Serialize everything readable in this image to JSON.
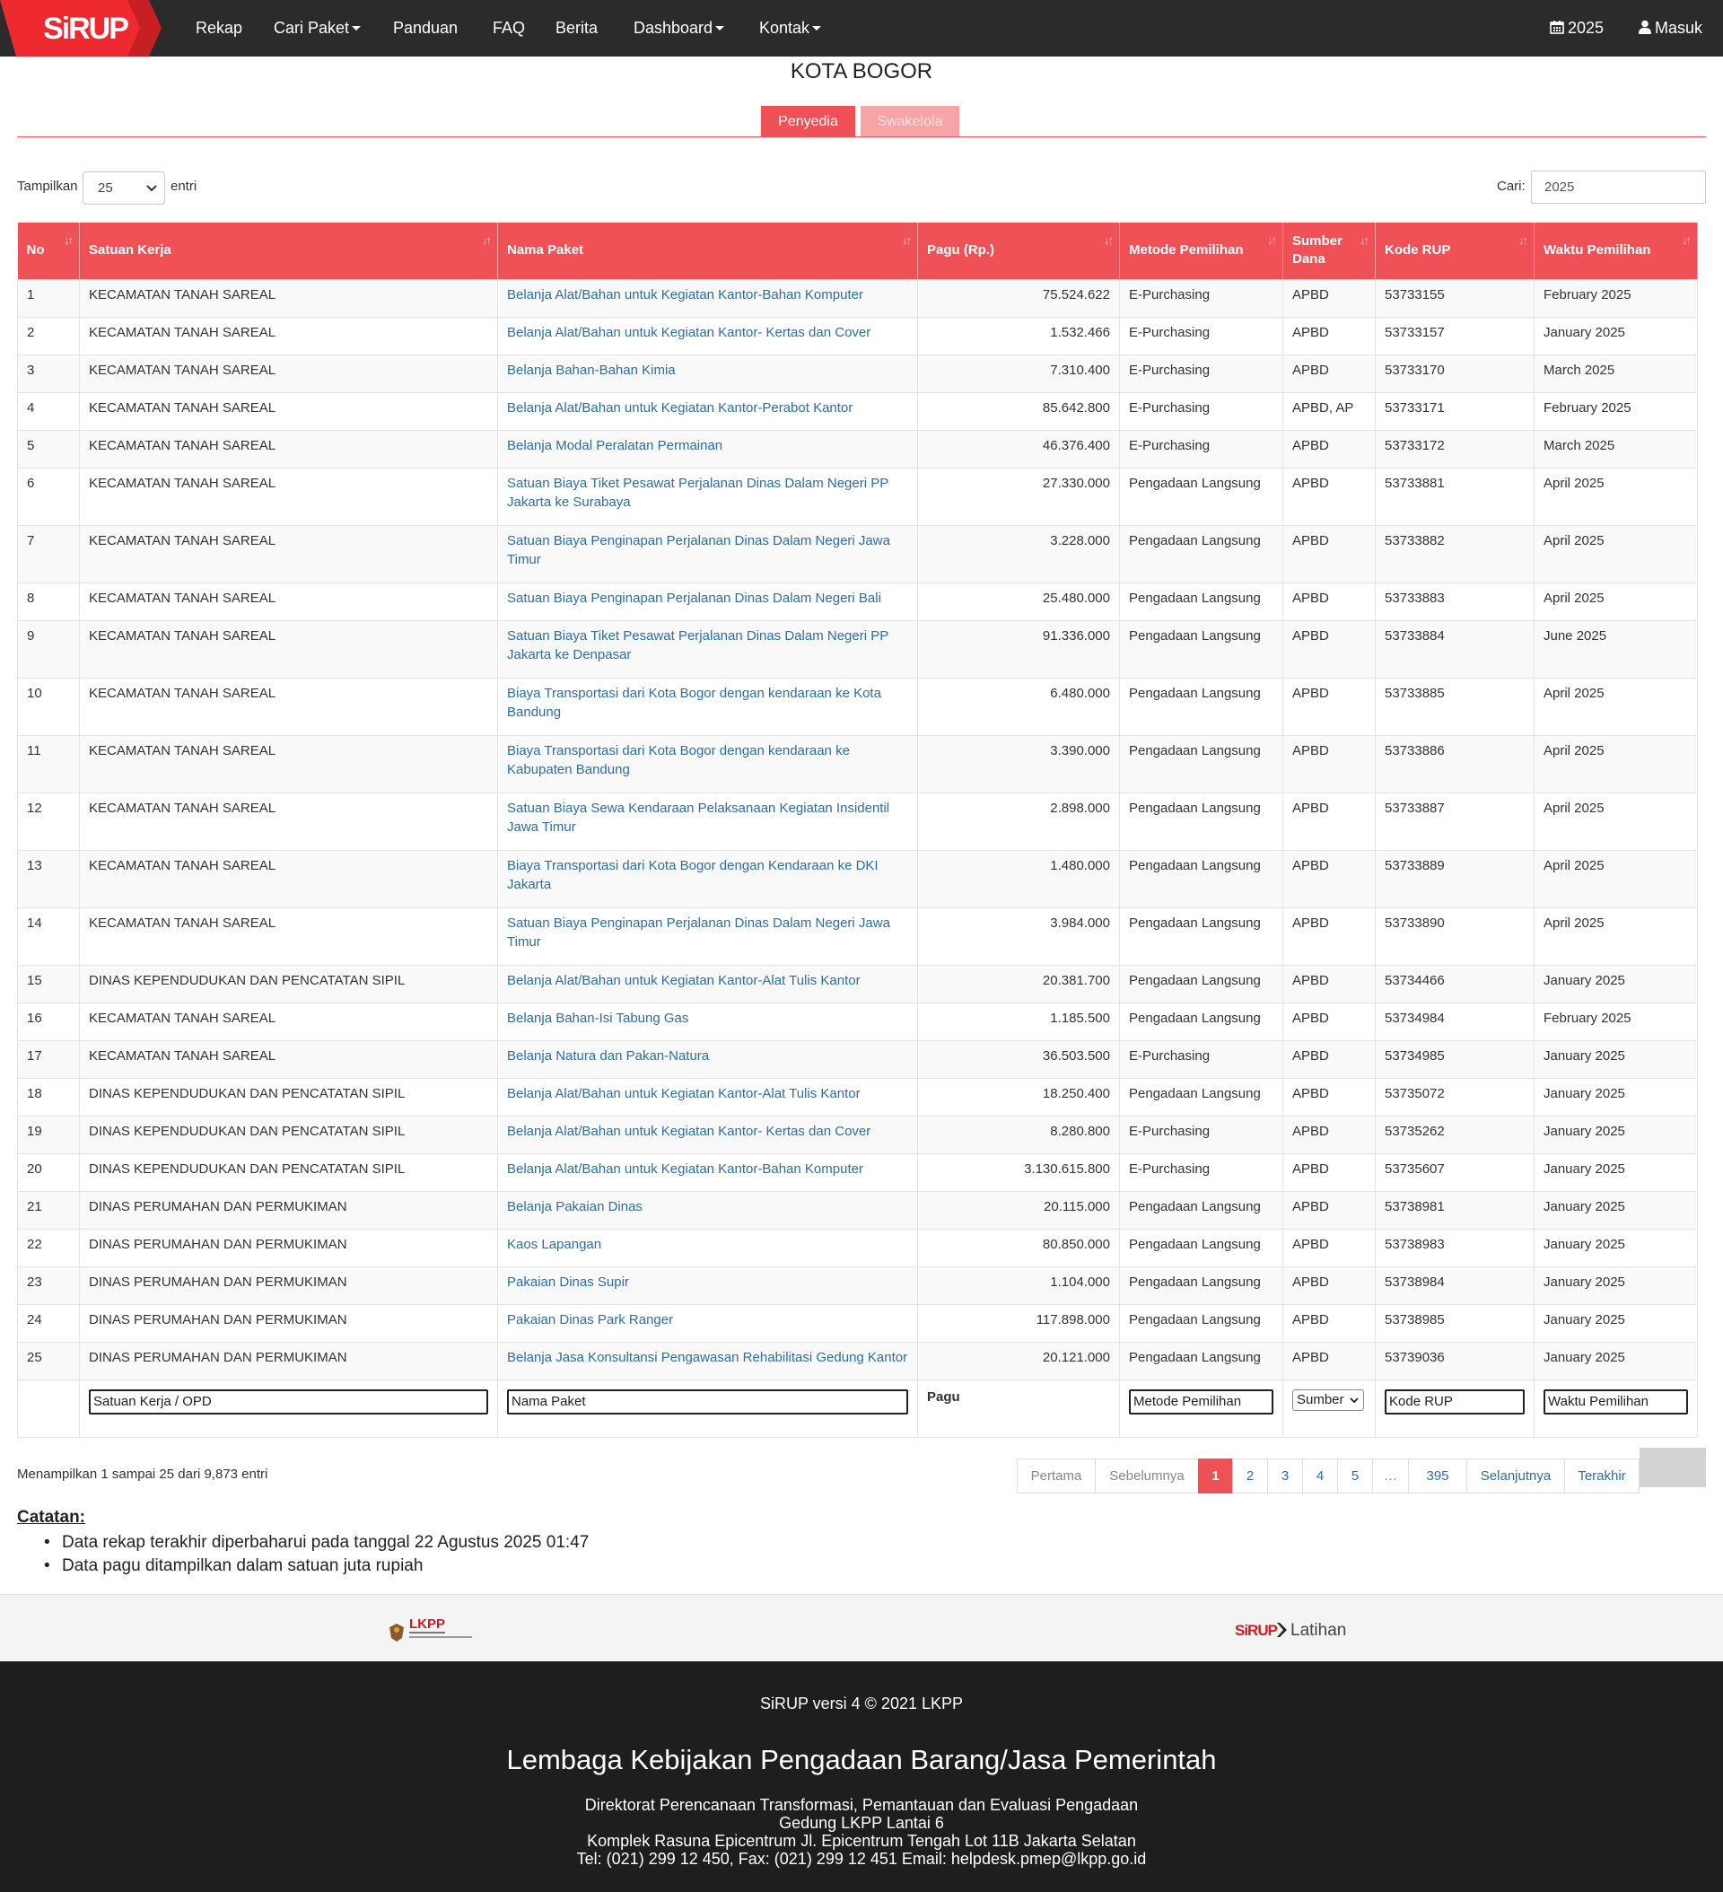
{
  "nav": {
    "items": [
      {
        "label": "Rekap",
        "caret": false
      },
      {
        "label": "Cari Paket",
        "caret": true
      },
      {
        "label": "Panduan",
        "caret": false
      },
      {
        "label": "FAQ",
        "caret": false
      },
      {
        "label": "Berita",
        "caret": false
      },
      {
        "label": "Dashboard",
        "caret": true
      },
      {
        "label": "Kontak",
        "caret": true
      }
    ],
    "year": "2025",
    "login": "Masuk",
    "logo_text": "SiRUP"
  },
  "page": {
    "title": "KOTA BOGOR",
    "tabs": [
      "Penyedia",
      "Swakelola"
    ]
  },
  "controls": {
    "show_label": "Tampilkan",
    "show_value": "25",
    "entries_label": "entri",
    "search_label": "Cari:",
    "search_value": "2025"
  },
  "table": {
    "headers": [
      "No",
      "Satuan Kerja",
      "Nama Paket",
      "Pagu (Rp.)",
      "Metode Pemilihan",
      "Sumber Dana",
      "Kode RUP",
      "Waktu Pemilihan"
    ],
    "rows": [
      [
        "1",
        "KECAMATAN TANAH SAREAL",
        "Belanja Alat/Bahan untuk Kegiatan Kantor-Bahan Komputer",
        "75.524.622",
        "E-Purchasing",
        "APBD",
        "53733155",
        "February 2025"
      ],
      [
        "2",
        "KECAMATAN TANAH SAREAL",
        "Belanja Alat/Bahan untuk Kegiatan Kantor- Kertas dan Cover",
        "1.532.466",
        "E-Purchasing",
        "APBD",
        "53733157",
        "January 2025"
      ],
      [
        "3",
        "KECAMATAN TANAH SAREAL",
        "Belanja Bahan-Bahan Kimia",
        "7.310.400",
        "E-Purchasing",
        "APBD",
        "53733170",
        "March 2025"
      ],
      [
        "4",
        "KECAMATAN TANAH SAREAL",
        "Belanja Alat/Bahan untuk Kegiatan Kantor-Perabot Kantor",
        "85.642.800",
        "E-Purchasing",
        "APBD, AP",
        "53733171",
        "February 2025"
      ],
      [
        "5",
        "KECAMATAN TANAH SAREAL",
        "Belanja Modal Peralatan Permainan",
        "46.376.400",
        "E-Purchasing",
        "APBD",
        "53733172",
        "March 2025"
      ],
      [
        "6",
        "KECAMATAN TANAH SAREAL",
        "Satuan Biaya Tiket Pesawat Perjalanan Dinas Dalam Negeri PP Jakarta ke Surabaya",
        "27.330.000",
        "Pengadaan Langsung",
        "APBD",
        "53733881",
        "April 2025"
      ],
      [
        "7",
        "KECAMATAN TANAH SAREAL",
        "Satuan Biaya Penginapan Perjalanan Dinas Dalam Negeri Jawa Timur",
        "3.228.000",
        "Pengadaan Langsung",
        "APBD",
        "53733882",
        "April 2025"
      ],
      [
        "8",
        "KECAMATAN TANAH SAREAL",
        "Satuan Biaya Penginapan Perjalanan Dinas Dalam Negeri Bali",
        "25.480.000",
        "Pengadaan Langsung",
        "APBD",
        "53733883",
        "April 2025"
      ],
      [
        "9",
        "KECAMATAN TANAH SAREAL",
        "Satuan Biaya Tiket Pesawat Perjalanan Dinas Dalam Negeri PP Jakarta ke Denpasar",
        "91.336.000",
        "Pengadaan Langsung",
        "APBD",
        "53733884",
        "June 2025"
      ],
      [
        "10",
        "KECAMATAN TANAH SAREAL",
        "Biaya Transportasi dari Kota Bogor dengan kendaraan ke Kota Bandung",
        "6.480.000",
        "Pengadaan Langsung",
        "APBD",
        "53733885",
        "April 2025"
      ],
      [
        "11",
        "KECAMATAN TANAH SAREAL",
        "Biaya Transportasi dari Kota Bogor dengan kendaraan ke Kabupaten Bandung",
        "3.390.000",
        "Pengadaan Langsung",
        "APBD",
        "53733886",
        "April 2025"
      ],
      [
        "12",
        "KECAMATAN TANAH SAREAL",
        "Satuan Biaya Sewa Kendaraan Pelaksanaan Kegiatan Insidentil Jawa Timur",
        "2.898.000",
        "Pengadaan Langsung",
        "APBD",
        "53733887",
        "April 2025"
      ],
      [
        "13",
        "KECAMATAN TANAH SAREAL",
        "Biaya Transportasi dari Kota Bogor dengan Kendaraan ke DKI Jakarta",
        "1.480.000",
        "Pengadaan Langsung",
        "APBD",
        "53733889",
        "April 2025"
      ],
      [
        "14",
        "KECAMATAN TANAH SAREAL",
        "Satuan Biaya Penginapan Perjalanan Dinas Dalam Negeri Jawa Timur",
        "3.984.000",
        "Pengadaan Langsung",
        "APBD",
        "53733890",
        "April 2025"
      ],
      [
        "15",
        "DINAS KEPENDUDUKAN DAN PENCATATAN SIPIL",
        "Belanja Alat/Bahan untuk Kegiatan Kantor-Alat Tulis Kantor",
        "20.381.700",
        "Pengadaan Langsung",
        "APBD",
        "53734466",
        "January 2025"
      ],
      [
        "16",
        "KECAMATAN TANAH SAREAL",
        "Belanja Bahan-Isi Tabung Gas",
        "1.185.500",
        "Pengadaan Langsung",
        "APBD",
        "53734984",
        "February 2025"
      ],
      [
        "17",
        "KECAMATAN TANAH SAREAL",
        "Belanja Natura dan Pakan-Natura",
        "36.503.500",
        "E-Purchasing",
        "APBD",
        "53734985",
        "January 2025"
      ],
      [
        "18",
        "DINAS KEPENDUDUKAN DAN PENCATATAN SIPIL",
        "Belanja Alat/Bahan untuk Kegiatan Kantor-Alat Tulis Kantor",
        "18.250.400",
        "Pengadaan Langsung",
        "APBD",
        "53735072",
        "January 2025"
      ],
      [
        "19",
        "DINAS KEPENDUDUKAN DAN PENCATATAN SIPIL",
        "Belanja Alat/Bahan untuk Kegiatan Kantor- Kertas dan Cover",
        "8.280.800",
        "E-Purchasing",
        "APBD",
        "53735262",
        "January 2025"
      ],
      [
        "20",
        "DINAS KEPENDUDUKAN DAN PENCATATAN SIPIL",
        "Belanja Alat/Bahan untuk Kegiatan Kantor-Bahan Komputer",
        "3.130.615.800",
        "E-Purchasing",
        "APBD",
        "53735607",
        "January 2025"
      ],
      [
        "21",
        "DINAS PERUMAHAN DAN PERMUKIMAN",
        "Belanja Pakaian Dinas",
        "20.115.000",
        "Pengadaan Langsung",
        "APBD",
        "53738981",
        "January 2025"
      ],
      [
        "22",
        "DINAS PERUMAHAN DAN PERMUKIMAN",
        "Kaos Lapangan",
        "80.850.000",
        "Pengadaan Langsung",
        "APBD",
        "53738983",
        "January 2025"
      ],
      [
        "23",
        "DINAS PERUMAHAN DAN PERMUKIMAN",
        "Pakaian Dinas Supir",
        "1.104.000",
        "Pengadaan Langsung",
        "APBD",
        "53738984",
        "January 2025"
      ],
      [
        "24",
        "DINAS PERUMAHAN DAN PERMUKIMAN",
        "Pakaian Dinas Park Ranger",
        "117.898.000",
        "Pengadaan Langsung",
        "APBD",
        "53738985",
        "January 2025"
      ],
      [
        "25",
        "DINAS PERUMAHAN DAN PERMUKIMAN",
        "Belanja Jasa Konsultansi Pengawasan Rehabilitasi Gedung Kantor",
        "20.121.000",
        "Pengadaan Langsung",
        "APBD",
        "53739036",
        "January 2025"
      ]
    ],
    "filters": {
      "satuan_kerja": "Satuan Kerja / OPD",
      "nama_paket": "Nama Paket",
      "pagu": "Pagu",
      "metode": "Metode Pemilihan",
      "sumber": "Sumber",
      "kode_rup": "Kode RUP",
      "waktu": "Waktu Pemilihan"
    }
  },
  "info": "Menampilkan 1 sampai 25 dari 9,873 entri",
  "pagination": {
    "items": [
      {
        "label": "Pertama",
        "state": "disabled"
      },
      {
        "label": "Sebelumnya",
        "state": "disabled"
      },
      {
        "label": "1",
        "state": "active"
      },
      {
        "label": "2",
        "state": ""
      },
      {
        "label": "3",
        "state": ""
      },
      {
        "label": "4",
        "state": ""
      },
      {
        "label": "5",
        "state": ""
      },
      {
        "label": "…",
        "state": "disabled"
      },
      {
        "label": "395",
        "state": ""
      },
      {
        "label": "Selanjutnya",
        "state": ""
      },
      {
        "label": "Terakhir",
        "state": ""
      }
    ]
  },
  "notes": {
    "title": "Catatan:",
    "items": [
      "Data rekap terakhir diperbaharui pada tanggal 22 Agustus 2025 01:47",
      "Data pagu ditampilkan dalam satuan juta rupiah"
    ]
  },
  "footer": {
    "logo_lkpp": "LKPP",
    "logo_sirup": "SiRUP",
    "logo_sirup_suffix": "Latihan",
    "version": "SiRUP versi 4 © 2021 LKPP",
    "org": "Lembaga Kebijakan Pengadaan Barang/Jasa Pemerintah",
    "address": [
      "Direktorat Perencanaan Transformasi, Pemantauan dan Evaluasi Pengadaan",
      "Gedung LKPP Lantai 6",
      "Komplek Rasuna Epicentrum Jl. Epicentrum Tengah Lot 11B Jakarta Selatan",
      "Tel: (021) 299 12 450, Fax: (021) 299 12 451 Email: helpdesk.pmep@lkpp.go.id"
    ]
  },
  "colors": {
    "brand_red": "#f05156",
    "navbar_bg": "#2b2b2b",
    "link": "#2e6da4"
  }
}
